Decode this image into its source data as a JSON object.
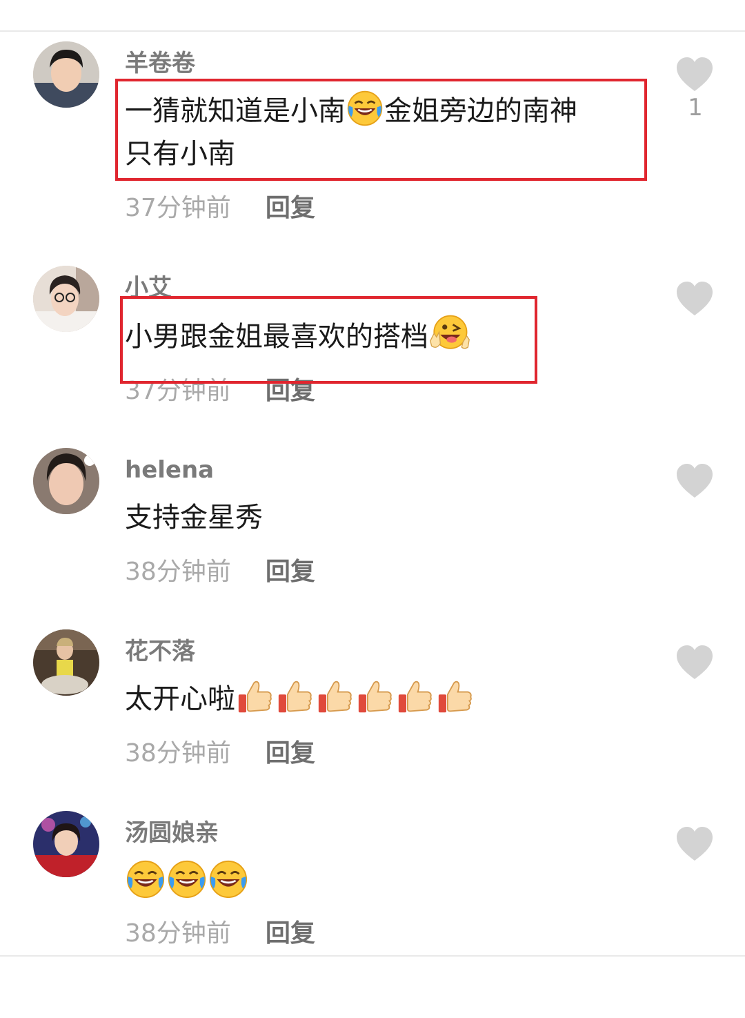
{
  "comments": [
    {
      "username": "羊卷卷",
      "text_line1": "一猜就知道是小南",
      "text_line1_emoji": "laughing-crying-emoji",
      "text_line1_after": "金姐旁边的南神",
      "text_line2": "只有小南",
      "time": "37分钟前",
      "reply": "回复",
      "likes": "1",
      "highlighted": true
    },
    {
      "username": "小艾",
      "text": "小男跟金姐最喜欢的搭档",
      "emoji": "winking-tongue-emoji",
      "time": "37分钟前",
      "reply": "回复",
      "highlighted": true
    },
    {
      "username": "helena",
      "text": "支持金星秀",
      "time": "38分钟前",
      "reply": "回复"
    },
    {
      "username": "花不落",
      "text": "太开心啦",
      "emoji": "thumbs-up-emoji",
      "emoji_count": 6,
      "time": "38分钟前",
      "reply": "回复"
    },
    {
      "username": "汤圆娘亲",
      "text": "",
      "emoji": "laughing-crying-emoji",
      "emoji_count": 3,
      "time": "38分钟前",
      "reply": "回复"
    }
  ],
  "icons": {
    "like": "heart-icon",
    "avatar": "avatar"
  },
  "colors": {
    "highlight_box": "#e0262f",
    "like_icon": "#d3d3d3",
    "username": "#7a7a7a",
    "time": "#a9a9a9",
    "reply": "#6e6e6e"
  }
}
